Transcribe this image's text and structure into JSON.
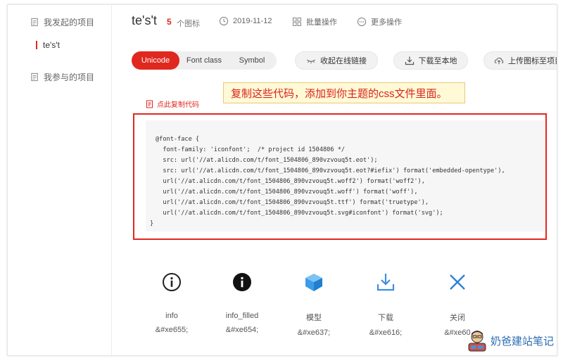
{
  "sidebar": {
    "my_projects": "我发起的项目",
    "current_project": "te's't",
    "joined_projects": "我参与的项目"
  },
  "header": {
    "project_name": "te's't",
    "icon_count": "5",
    "icon_count_label": "个图标",
    "date": "2019-11-12",
    "batch_ops": "批量操作",
    "more_ops": "更多操作"
  },
  "tabs": [
    "Unicode",
    "Font class",
    "Symbol"
  ],
  "toolbar": {
    "collapse_link": "收起在线链接",
    "download": "下载至本地",
    "upload": "上传图标至项目"
  },
  "callout": "复制这些代码，添加到你主题的css文件里面。",
  "copy_link": "点此复制代码",
  "code": [
    "@font-face {",
    "  font-family: 'iconfont';  /* project id 1504806 */",
    "  src: url('//at.alicdn.com/t/font_1504806_890vzvouq5t.eot');",
    "  src: url('//at.alicdn.com/t/font_1504806_890vzvouq5t.eot?#iefix') format('embedded-opentype'),",
    "  url('//at.alicdn.com/t/font_1504806_890vzvouq5t.woff2') format('woff2'),",
    "  url('//at.alicdn.com/t/font_1504806_890vzvouq5t.woff') format('woff'),",
    "  url('//at.alicdn.com/t/font_1504806_890vzvouq5t.ttf') format('truetype'),",
    "  url('//at.alicdn.com/t/font_1504806_890vzvouq5t.svg#iconfont') format('svg');",
    "}"
  ],
  "icons": [
    {
      "name": "info",
      "code": "&#xe655;",
      "icon": "info-outline-icon",
      "color": "#222222"
    },
    {
      "name": "info_filled",
      "code": "&#xe654;",
      "icon": "info-filled-icon",
      "color": "#111111"
    },
    {
      "name": "模型",
      "code": "&#xe637;",
      "icon": "cube-icon",
      "color": "#3d9be9"
    },
    {
      "name": "下载",
      "code": "&#xe616;",
      "icon": "download-icon",
      "color": "#3d8fe0"
    },
    {
      "name": "关闭",
      "code": "&#xe60",
      "icon": "close-icon",
      "color": "#2f80d8"
    }
  ],
  "watermark": "奶爸建站笔记",
  "colors": {
    "accent": "#e0281f",
    "callout_bg": "#fff9d6",
    "code_bg": "#f6f6f6"
  }
}
